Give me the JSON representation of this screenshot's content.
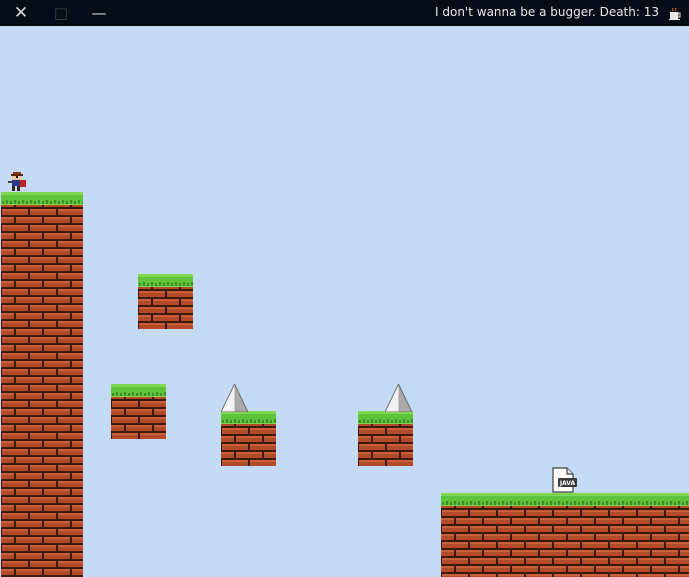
{
  "window": {
    "title": "I don't wanna be a bugger.  Death: 13",
    "close_glyph": "✕",
    "maximize_glyph": "□",
    "minimize_glyph": "—",
    "app_icon": "java-coffee-icon"
  },
  "game": {
    "sky_color": "#c5daf5",
    "grass_color": "#5ec43a",
    "brick_color": "#b44a2a",
    "mortar_color": "#3a1a0a",
    "save_point_label": "JAVA"
  }
}
